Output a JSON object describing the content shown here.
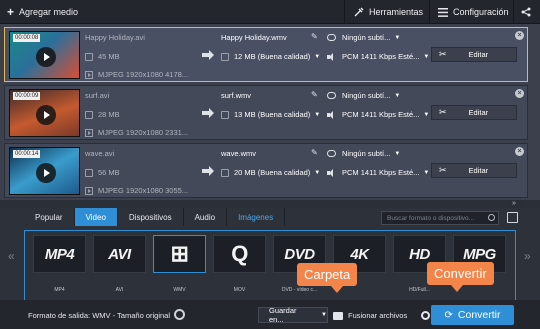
{
  "toolbar": {
    "add_media": "Agregar medio",
    "tools": "Herramientas",
    "settings": "Configuración"
  },
  "files": [
    {
      "duration": "00:00:08",
      "source_name": "Happy Holiday.avi",
      "source_size": "45 MB",
      "source_codec": "MJPEG 1920x1080 4178...",
      "output_name": "Happy Holiday.wmv",
      "output_size": "12 MB (Buena calidad)",
      "subtitles": "Ningún subtí...",
      "audio": "PCM 1411 Kbps Esté...",
      "edit_label": "Editar",
      "thumb_colors": [
        "#1a8a86",
        "#2a6f9a",
        "#d94e32"
      ]
    },
    {
      "duration": "00:00:09",
      "source_name": "surf.avi",
      "source_size": "28 MB",
      "source_codec": "MJPEG 1920x1080 2331...",
      "output_name": "surf.wmv",
      "output_size": "13 MB (Buena calidad)",
      "subtitles": "Ningún subtí...",
      "audio": "PCM 1411 Kbps Esté...",
      "edit_label": "Editar",
      "thumb_colors": [
        "#7a3a2a",
        "#c55a2e",
        "#3a2a2a"
      ]
    },
    {
      "duration": "00:00:14",
      "source_name": "wave.avi",
      "source_size": "56 MB",
      "source_codec": "MJPEG 1920x1080 3055...",
      "output_name": "wave.wmv",
      "output_size": "20 MB (Buena calidad)",
      "subtitles": "Ningún subtí...",
      "audio": "PCM 1411 Kbps Esté...",
      "edit_label": "Editar",
      "thumb_colors": [
        "#1c5a8a",
        "#3a9ccc",
        "#0d3050"
      ]
    }
  ],
  "format_tabs": [
    "Popular",
    "Video",
    "Dispositivos",
    "Audio",
    "Imágenes"
  ],
  "search_placeholder": "Buscar formato o dispositivo...",
  "formats": [
    {
      "logo": "MP4",
      "label": "MP4"
    },
    {
      "logo": "AVI",
      "label": "AVI"
    },
    {
      "logo": "⊞",
      "label": "WMV"
    },
    {
      "logo": "Q",
      "label": "MOV"
    },
    {
      "logo": "DVD",
      "label": "DVD - vídeo c..."
    },
    {
      "logo": "4K",
      "label": ""
    },
    {
      "logo": "HD",
      "label": "HD/Full..."
    },
    {
      "logo": "MPG",
      "label": ""
    }
  ],
  "bottom": {
    "output_format": "Formato de salida: WMV - Tamaño original",
    "save_to": "Guardar en...",
    "merge_files": "Fusionar archivos",
    "convert": "Convertir"
  },
  "callouts": {
    "folder": "Carpeta",
    "convert": "Convertir"
  },
  "colors": {
    "accent": "#2e8fd6",
    "callout": "#f4854a",
    "selected_border": "#e6b84a"
  }
}
